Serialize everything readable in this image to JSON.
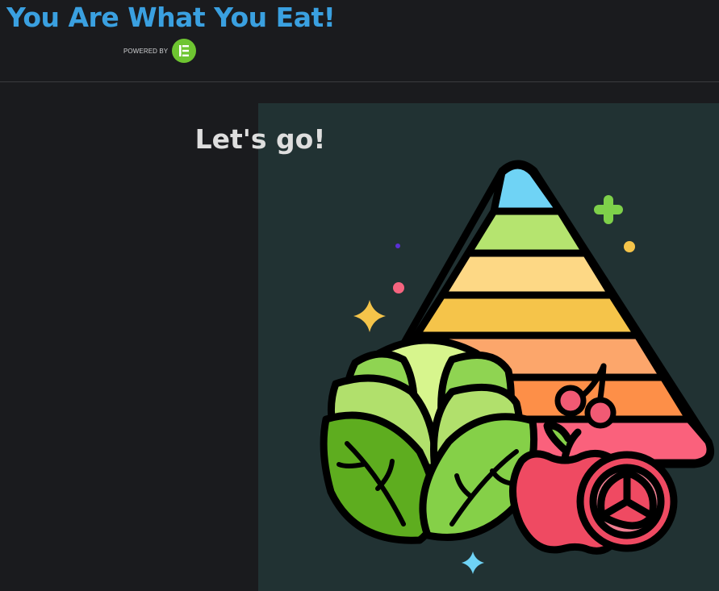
{
  "header": {
    "site_title": "You Are What You Eat!",
    "powered_by_label": "POWERED BY",
    "powered_by_logo_icon": "elementor-logo-icon",
    "title_color": "#3aa0e0",
    "logo_color": "#6ec531"
  },
  "hero": {
    "heading": "Let's go!",
    "background_color": "#213233",
    "illustration_icon": "food-pyramid-illustration"
  }
}
